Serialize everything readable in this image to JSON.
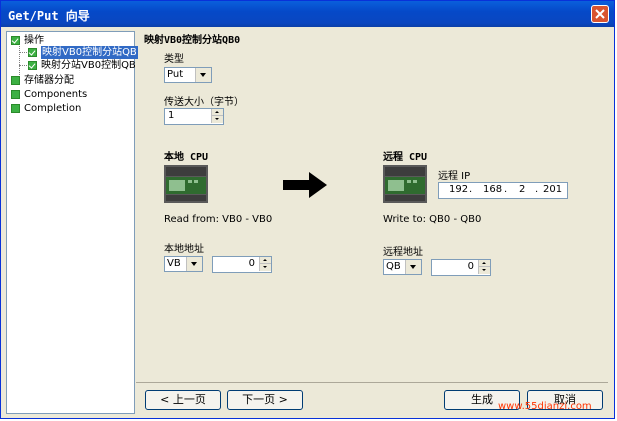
{
  "window": {
    "title": "Get/Put 向导"
  },
  "tree": {
    "items": [
      {
        "label": "操作",
        "checked": true
      },
      {
        "label": "映射VB0控制分站QB",
        "checked": true,
        "selected": true
      },
      {
        "label": "映射分站VB0控制QB",
        "checked": true
      },
      {
        "label": "存储器分配",
        "checked": false
      },
      {
        "label": "Components",
        "checked": false
      },
      {
        "label": "Completion",
        "checked": false
      }
    ]
  },
  "main": {
    "heading": "映射VB0控制分站QB0",
    "type_label": "类型",
    "type_value": "Put",
    "size_label": "传送大小（字节）",
    "size_value": "1",
    "local": {
      "title": "本地 CPU",
      "read_text": "Read from: VB0 - VB0",
      "addr_label": "本地地址",
      "addr_type": "VB",
      "addr_value": "0"
    },
    "remote": {
      "title": "远程 CPU",
      "ip_label": "远程 IP",
      "ip": [
        "192",
        "168",
        "2",
        "201"
      ],
      "write_text": "Write to: QB0 - QB0",
      "addr_label": "远程地址",
      "addr_type": "QB",
      "addr_value": "0"
    }
  },
  "buttons": {
    "prev": "< 上一页",
    "next": "下一页 >",
    "generate": "生成",
    "cancel": "取消"
  },
  "watermark": "www.55dianzi.com",
  "colors": {
    "titlebar": "#0a5fdc",
    "cpu_green": "#2f6b2f"
  },
  "icons": [
    "close-icon",
    "checkbox-icon",
    "plc-cpu-icon",
    "right-arrow-icon"
  ]
}
